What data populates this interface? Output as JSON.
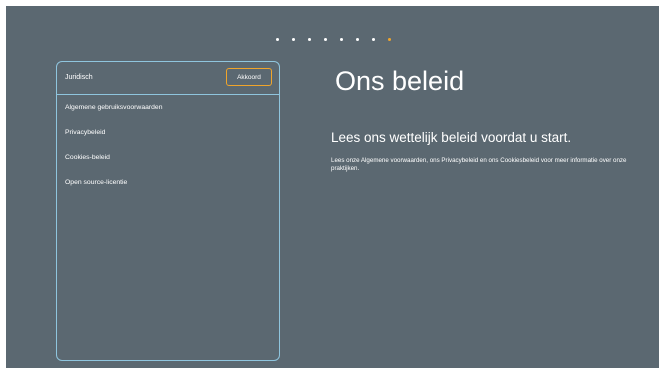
{
  "pager": {
    "total": 8,
    "active_index": 7,
    "active_color": "#f0a52b",
    "dot_color": "#ffffff"
  },
  "panel": {
    "title": "Juridisch",
    "accept_label": "Akkoord",
    "items": [
      {
        "label": "Algemene gebruiksvoorwaarden"
      },
      {
        "label": "Privacybeleid"
      },
      {
        "label": "Cookies-beleid"
      },
      {
        "label": "Open source-licentie"
      }
    ]
  },
  "main": {
    "heading": "Ons beleid",
    "subheading": "Lees ons wettelijk beleid voordat u start.",
    "description": "Lees onze Algemene voorwaarden, ons Privacybeleid en ons Cookiesbeleid voor meer informatie over onze praktijken."
  },
  "colors": {
    "background": "#5b6871",
    "panel_border": "#8fc5de",
    "accent": "#f0a52b",
    "text": "#ffffff"
  }
}
